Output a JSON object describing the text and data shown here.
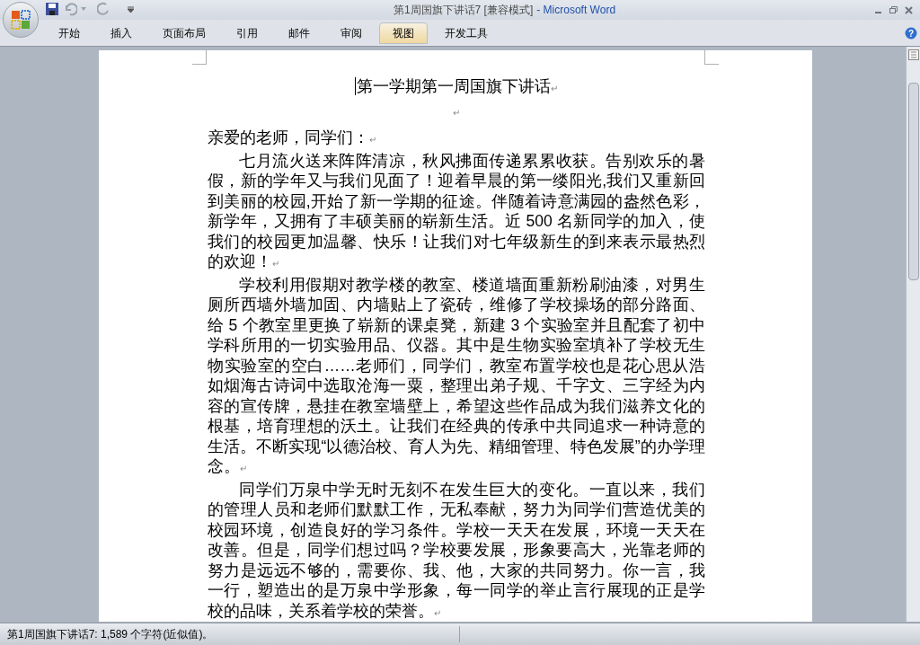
{
  "window": {
    "document_title": "第1周国旗下讲话7 [兼容模式]",
    "app_name": "- Microsoft Word"
  },
  "tabs": [
    {
      "label": "开始",
      "selected": false
    },
    {
      "label": "插入",
      "selected": false
    },
    {
      "label": "页面布局",
      "selected": false
    },
    {
      "label": "引用",
      "selected": false
    },
    {
      "label": "邮件",
      "selected": false
    },
    {
      "label": "审阅",
      "selected": false
    },
    {
      "label": "视图",
      "selected": true
    },
    {
      "label": "开发工具",
      "selected": false
    }
  ],
  "document": {
    "title": "第一学期第一周国旗下讲话",
    "paragraphs": [
      {
        "kind": "empty",
        "mark": "↵"
      },
      {
        "kind": "salutation",
        "text": "亲爱的老师，同学们：",
        "mark": "↵"
      },
      {
        "kind": "body",
        "text": "七月流火送来阵阵清凉，秋风拂面传递累累收获。告别欢乐的暑假，新的学年又与我们见面了！迎着早晨的第一缕阳光,我们又重新回到美丽的校园,开始了新一学期的征途。伴随着诗意满园的盎然色彩，新学年，又拥有了丰硕美丽的崭新生活。近 500 名新同学的加入，使我们的校园更加温馨、快乐！让我们对七年级新生的到来表示最热烈的欢迎！",
        "mark": "↵"
      },
      {
        "kind": "body",
        "text": "学校利用假期对教学楼的教室、楼道墙面重新粉刷油漆，对男生厕所西墙外墙加固、内墙贴上了瓷砖，维修了学校操场的部分路面、给 5 个教室里更换了崭新的课桌凳，新建 3 个实验室并且配套了初中学科所用的一切实验用品、仪器。其中是生物实验室填补了学校无生物实验室的空白……老师们，同学们，教室布置学校也是花心思从浩如烟海古诗词中选取沧海一粟，整理出弟子规、千字文、三字经为内容的宣传牌，悬挂在教室墙壁上，希望这些作品成为我们滋养文化的根基，培育理想的沃土。让我们在经典的传承中共同追求一种诗意的生活。不断实现“以德治校、育人为先、精细管理、特色发展”的办学理念。",
        "mark": "↵"
      },
      {
        "kind": "body",
        "text": "同学们万泉中学无时无刻不在发生巨大的变化。一直以来，我们的管理人员和老师们默默工作，无私奉献，努力为同学们营造优美的校园环境，创造良好的学习条件。学校一天天在发展，环境一天天在改善。但是，同学们想过吗？学校要发展，形象要高大，光靠老师的努力是远远不够的，需要你、我、他，大家的共同努力。你一言，我一行，塑造出的是万泉中学形象，每一同学的举止言行展现的正是学校的品味，关系着学校的荣誉。",
        "mark": "↵"
      }
    ],
    "title_mark": "↵"
  },
  "help_button": "?",
  "status_bar": {
    "text": "第1周国旗下讲话7: 1,589 个字符(近似值)。"
  }
}
